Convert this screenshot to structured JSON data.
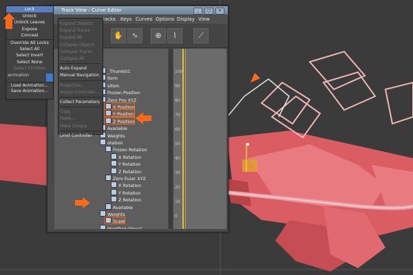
{
  "colors": {
    "accent": "#ff6a1a",
    "highlight": "#5a7fbf",
    "geometry": "#e05d63"
  },
  "window": {
    "title": "Track View - Curve Editor",
    "title_prefix": "",
    "buttons": [
      "_",
      "□",
      "✕"
    ]
  },
  "menubar": [
    "racks",
    "Keys",
    "Curves",
    "Options",
    "Display",
    "View"
  ],
  "toolbar": [
    "pan-icon",
    "curve-icon",
    "key-icon",
    "tangent-icon",
    "line-icon"
  ],
  "left_menu": {
    "items": [
      {
        "label": "Lock",
        "state": "selected"
      },
      {
        "label": "Unlock",
        "state": "normal"
      },
      {
        "label": "Unlock Leaves",
        "state": "normal"
      },
      {
        "label": "Expose",
        "state": "normal"
      },
      {
        "label": "Conceal",
        "state": "normal"
      },
      {
        "label": "Override All Locks",
        "state": "normal"
      },
      {
        "label": "Select All",
        "state": "normal"
      },
      {
        "label": "Select Invert",
        "state": "normal"
      },
      {
        "label": "Select None",
        "state": "normal"
      },
      {
        "label": "Select Children",
        "state": "disabled"
      },
      {
        "label": "animation",
        "state": "small"
      },
      {
        "label": "Load Animation...",
        "state": "normal"
      },
      {
        "label": "Save Animation...",
        "state": "normal"
      }
    ]
  },
  "context_menu": {
    "items": [
      {
        "label": "Expand Objects",
        "state": "disabled"
      },
      {
        "label": "Expand Tracks",
        "state": "disabled"
      },
      {
        "label": "Expand All",
        "state": "disabled"
      },
      {
        "label": "Collapse Objects",
        "state": "disabled"
      },
      {
        "label": "Collapse Tracks",
        "state": "disabled"
      },
      {
        "label": "Collapse All",
        "state": "disabled"
      },
      {
        "label": "Auto Expand",
        "state": "normal"
      },
      {
        "label": "Manual Navigation",
        "state": "normal"
      },
      {
        "label": "Properties...",
        "state": "disabled"
      },
      {
        "label": "Assign Controller...",
        "state": "disabled"
      },
      {
        "label": "Collect Parameters",
        "state": "normal"
      },
      {
        "label": "Copy",
        "state": "disabled"
      },
      {
        "label": "Paste...",
        "state": "disabled"
      },
      {
        "label": "Make Unique",
        "state": "disabled"
      },
      {
        "label": "Limit Controller",
        "state": "normal"
      }
    ]
  },
  "tree": [
    {
      "label": "_Thumb01",
      "indent": 0
    },
    {
      "label": "form",
      "indent": 0
    },
    {
      "label": "sition",
      "indent": 0
    },
    {
      "label": "Frozen Position",
      "indent": 0
    },
    {
      "label": "Zero Pos XYZ",
      "indent": 0
    },
    {
      "label": "X Position",
      "indent": 1,
      "hl": true
    },
    {
      "label": "Y Position",
      "indent": 1,
      "hl": true
    },
    {
      "label": "Z Position",
      "indent": 1,
      "hl": true
    },
    {
      "label": "Available",
      "indent": 0
    },
    {
      "label": "Weights",
      "indent": 0
    },
    {
      "label": "otation",
      "indent": 0
    },
    {
      "label": "Frozen Rotation",
      "indent": 1
    },
    {
      "label": "X Rotation",
      "indent": 2
    },
    {
      "label": "Y Rotation",
      "indent": 2
    },
    {
      "label": "Z Rotation",
      "indent": 2
    },
    {
      "label": "Zero Euler XYZ",
      "indent": 1
    },
    {
      "label": "X Rotation",
      "indent": 2
    },
    {
      "label": "Y Rotation",
      "indent": 2
    },
    {
      "label": "Z Rotation",
      "indent": 2
    },
    {
      "label": "Available",
      "indent": 1
    },
    {
      "label": "Weights",
      "indent": 0
    },
    {
      "label": "Scale",
      "indent": 1,
      "hl": true
    },
    {
      "label": "Modified Object",
      "indent": 0
    }
  ],
  "ruler": [
    "100",
    "90",
    "80",
    "70",
    "60",
    "50",
    "40",
    "30",
    "20",
    "10",
    "0"
  ]
}
